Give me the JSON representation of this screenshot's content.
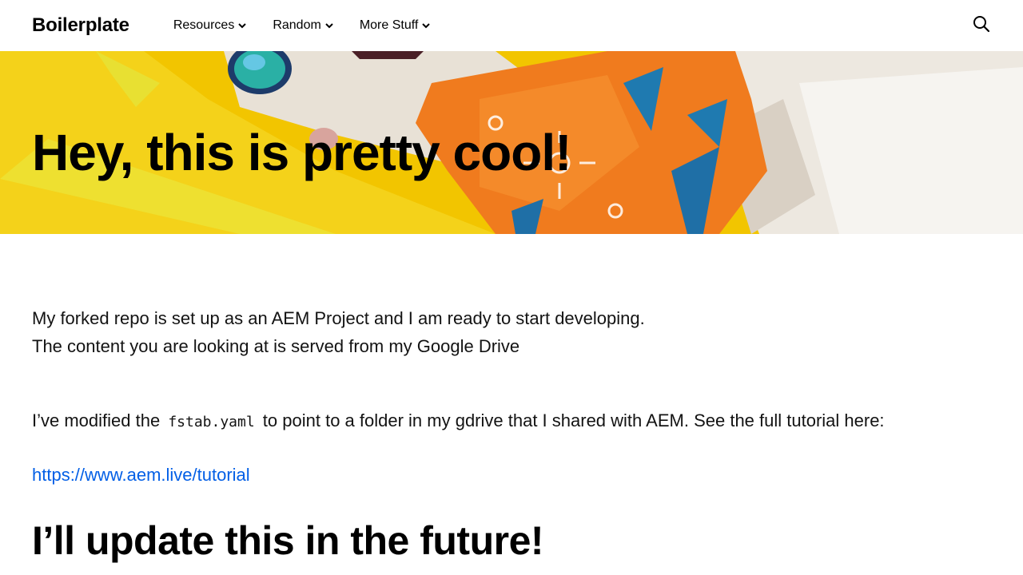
{
  "header": {
    "brand": "Boilerplate",
    "nav": [
      {
        "label": "Resources"
      },
      {
        "label": "Random"
      },
      {
        "label": "More Stuff"
      }
    ],
    "search_icon": "search-icon"
  },
  "hero": {
    "title": "Hey, this is pretty cool!"
  },
  "main": {
    "para1_line1": "My forked repo is set up as an AEM Project and I am ready to start developing.",
    "para1_line2": "The content you are looking at is served from my Google Drive",
    "para2_before": "I’ve modified the ",
    "para2_code": "fstab.yaml",
    "para2_after": " to point to a folder in my gdrive that I shared with AEM. See the full tutorial here:",
    "link": "https://www.aem.live/tutorial",
    "heading2": "I’ll update this in the future!"
  },
  "colors": {
    "link": "#035fe6",
    "hero_bg": "#f3c600"
  }
}
